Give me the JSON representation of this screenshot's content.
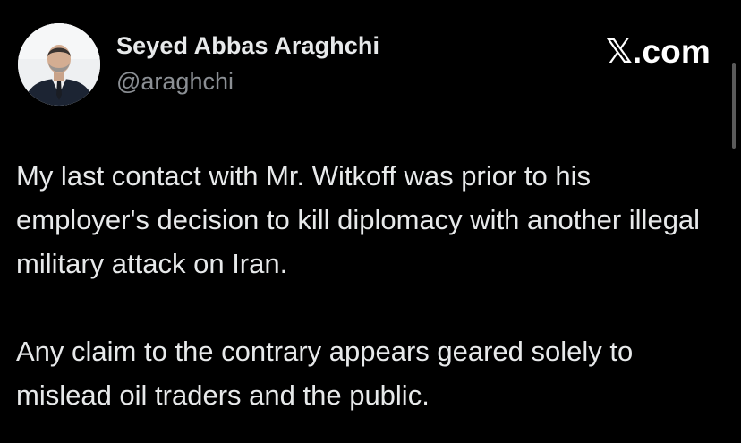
{
  "author": {
    "name": "Seyed Abbas Araghchi",
    "handle": "@araghchi",
    "avatar_icon": "profile-photo"
  },
  "brand": {
    "label": "𝕏.com"
  },
  "tweet": {
    "paragraphs": [
      "My last contact with Mr. Witkoff was prior to his employer's decision to kill diplomacy with another illegal military attack on Iran.",
      "Any claim to the contrary appears geared solely to mislead oil traders and the public."
    ]
  },
  "colors": {
    "background": "#000000",
    "text": "#e7e9ea",
    "handle": "#8b8f94"
  }
}
